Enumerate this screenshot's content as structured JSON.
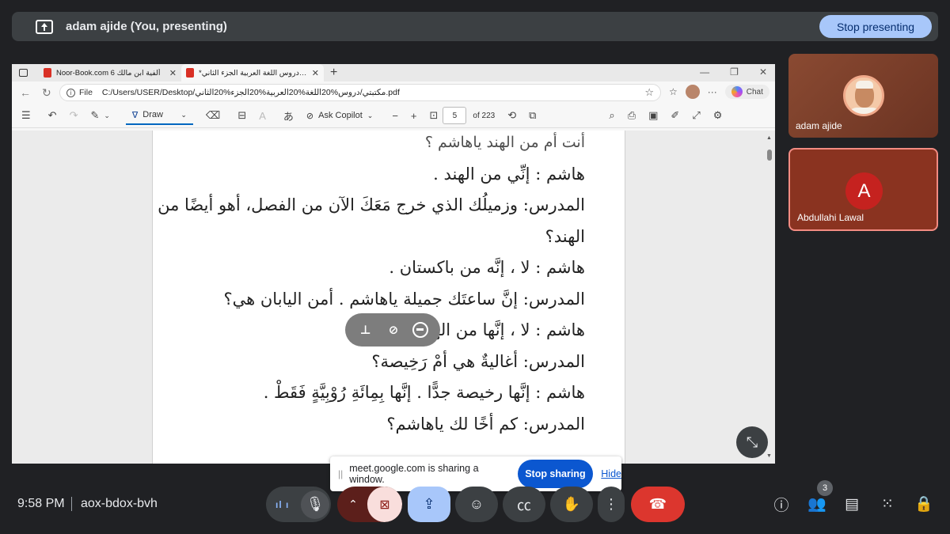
{
  "presenting_bar": {
    "title": "adam ajide (You, presenting)",
    "stop_label": "Stop presenting"
  },
  "browser": {
    "tabs": [
      {
        "title": "Noor-Book.com 6 ألفية ابن مالك",
        "active": false
      },
      {
        "title": "*دروس اللغة العربية الجزء الثاني.pdf",
        "active": true
      }
    ],
    "address": {
      "scheme": "File",
      "url": "C:/Users/USER/Desktop/مكتبتي/دروس%20اللغة%20العربية%20الجزء%20الثاني.pdf"
    },
    "chat_label": "Chat"
  },
  "pdf_toolbar": {
    "draw_label": "Draw",
    "ask_copilot_label": "Ask Copilot",
    "page_current": "5",
    "page_total": "of 223"
  },
  "document": {
    "lines": [
      "أنت أم من الهند ياهاشم ؟",
      "هاشم  : إنِّي من الهند .",
      "المدرس: وزميلُك الذي خرج مَعَكَ الآن من الفصل، أهو أيضًا من",
      "الهند؟",
      "هاشم  : لا ، إنَّه من باكستان .",
      "المدرس: إنَّ ساعتَك جميلة ياهاشم . أمن اليابان هي؟",
      "هاشم  : لا ، إنَّها من الهند .",
      "المدرس: أغاليةٌ هي أمْ رَخِيصة؟",
      "هاشم  : إنَّها رخيصة جدًّا . إنَّها بِمِائَةِ رُوْبِيَّةٍ فَقَطْ .",
      "المدرس: كم أخًا لك ياهاشم؟"
    ]
  },
  "sharing_bar": {
    "message": "meet.google.com is sharing a window.",
    "stop_label": "Stop sharing",
    "hide_label": "Hide"
  },
  "participants": [
    {
      "name": "adam ajide",
      "initial": ""
    },
    {
      "name": "Abdullahi Lawal",
      "initial": "A"
    }
  ],
  "meeting": {
    "time": "9:58 PM",
    "code": "aox-bdox-bvh",
    "people_count": "3"
  },
  "colors": {
    "background": "#202124",
    "present_accent": "#a8c7fa",
    "leave_red": "#dc362e",
    "speaking_border": "#f28b82"
  }
}
